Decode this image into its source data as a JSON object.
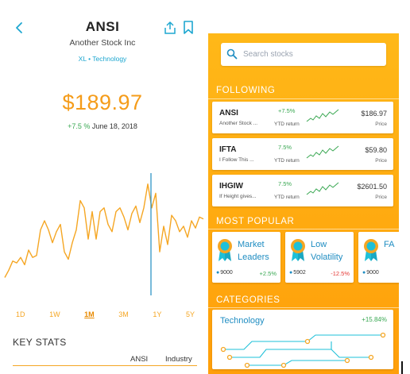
{
  "detail": {
    "ticker": "ANSI",
    "company": "Another Stock Inc",
    "meta": "XL • Technology",
    "price": "$189.97",
    "change_pct": "+7.5 %",
    "date": "June 18, 2018",
    "ranges": [
      "1D",
      "1W",
      "1M",
      "3M",
      "1Y",
      "5Y"
    ],
    "active_range": "1M",
    "key_stats_title": "KEY STATS",
    "col_ansi": "ANSI",
    "col_industry": "Industry",
    "chart_series": [
      48,
      52,
      57,
      56,
      59,
      55,
      63,
      59,
      60,
      74,
      79,
      74,
      67,
      73,
      77,
      62,
      58,
      67,
      74,
      90,
      86,
      69,
      84,
      69,
      84,
      86,
      77,
      73,
      84,
      86,
      81,
      74,
      83,
      87,
      78,
      86,
      99,
      86,
      94,
      62,
      76,
      66,
      82,
      79,
      73,
      76,
      70,
      79,
      75,
      81,
      80
    ]
  },
  "search": {
    "placeholder": "Search stocks"
  },
  "following": {
    "title": "FOLLOWING",
    "items": [
      {
        "ticker": "ANSI",
        "name": "Another Stock ...",
        "pct": "+7.5%",
        "label": "YTD return",
        "price": "$186.97",
        "price_label": "Price"
      },
      {
        "ticker": "IFTA",
        "name": "I Follow This ...",
        "pct": "7.5%",
        "label": "YTD return",
        "price": "$59.80",
        "price_label": "Price"
      },
      {
        "ticker": "IHGIW",
        "name": "If Height gives...",
        "pct": "7.5%",
        "label": "YTD return",
        "price": "$2601.50",
        "price_label": "Price"
      }
    ]
  },
  "popular": {
    "title": "MOST POPULAR",
    "items": [
      {
        "line1": "Market",
        "line2": "Leaders",
        "users": "9000",
        "perf": "+2.5%",
        "perf_color": "#3aa853"
      },
      {
        "line1": "Low",
        "line2": "Volatility",
        "users": "5902",
        "perf": "-12.5%",
        "perf_color": "#e53935"
      },
      {
        "line1": "FA",
        "line2": "",
        "users": "9000",
        "perf": "",
        "perf_color": "#3aa853"
      }
    ]
  },
  "categories": {
    "title": "CATEGORIES",
    "name": "Technology",
    "perf": "+15.84%"
  },
  "colors": {
    "orange": "#f59c1a",
    "blue": "#1ea7d0",
    "green": "#3aa853",
    "red": "#e53935"
  }
}
